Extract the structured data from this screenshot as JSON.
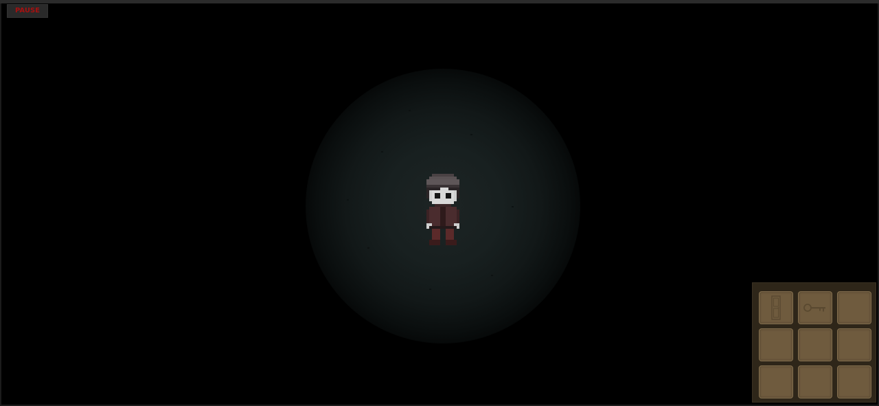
{
  "hud": {
    "pause_label": "PAUSE"
  },
  "player": {
    "sprite": "player-character-icon"
  },
  "inventory": {
    "slots": [
      {
        "item": "door-icon"
      },
      {
        "item": "key-icon"
      },
      {
        "item": ""
      },
      {
        "item": ""
      },
      {
        "item": ""
      },
      {
        "item": ""
      },
      {
        "item": ""
      },
      {
        "item": ""
      },
      {
        "item": ""
      }
    ]
  },
  "colors": {
    "background": "#000000",
    "pause_text": "#a61010",
    "pause_bg": "#2a2a2a",
    "inventory_panel": "#2e2619",
    "inventory_slot": "#6f5b3e",
    "item_tint": "#5a4930"
  }
}
